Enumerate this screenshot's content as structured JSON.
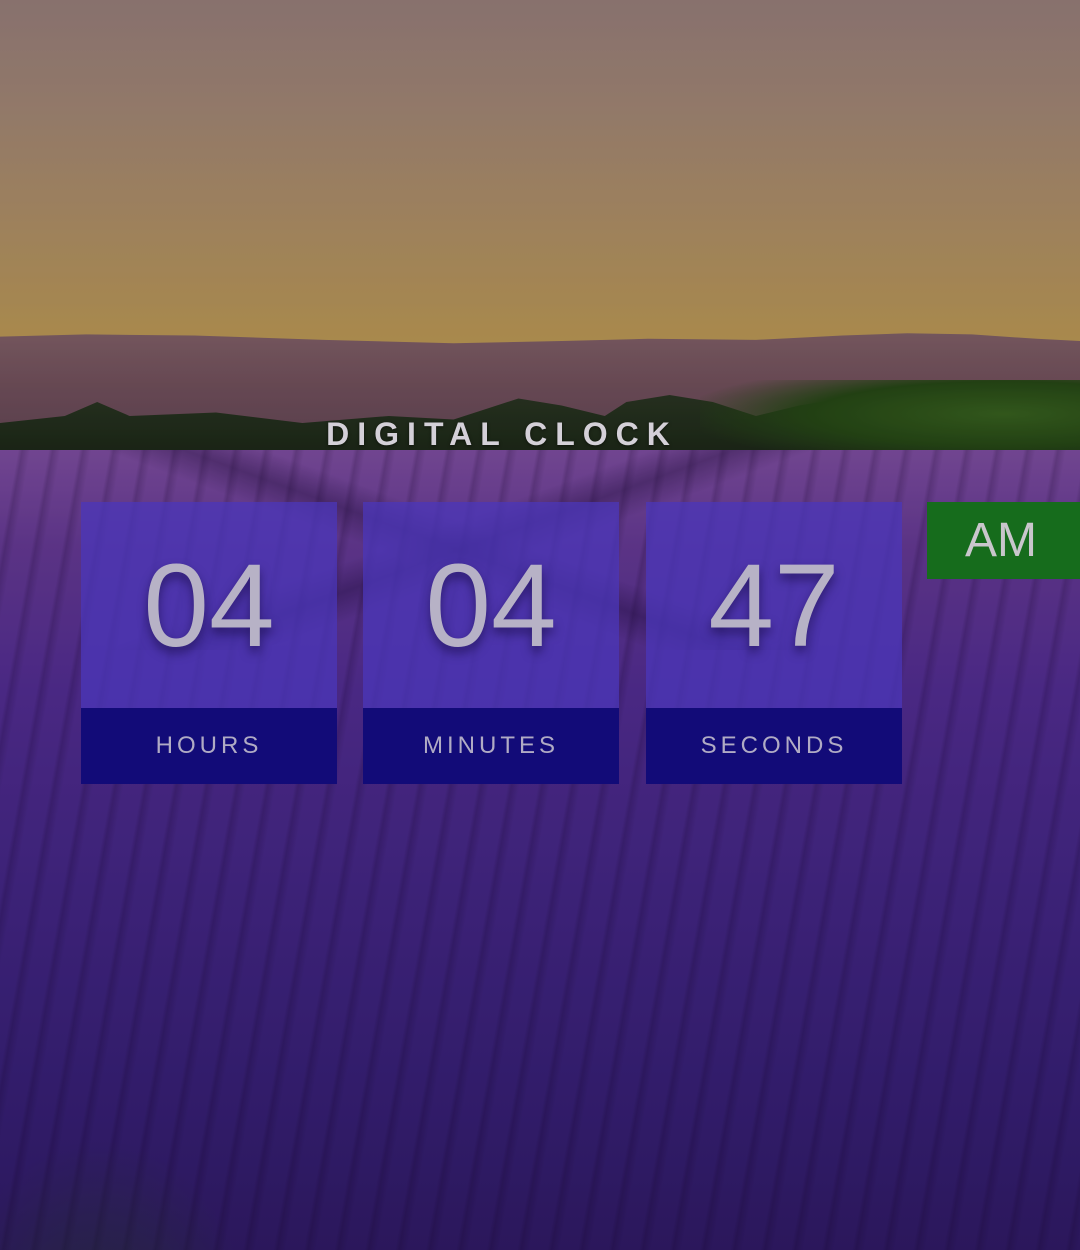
{
  "clock": {
    "title": "DIGITAL CLOCK",
    "hours": {
      "value": "04",
      "label": "HOURS"
    },
    "minutes": {
      "value": "04",
      "label": "MINUTES"
    },
    "seconds": {
      "value": "47",
      "label": "SECONDS"
    },
    "period": "AM"
  },
  "colors": {
    "value_panel": "#4b37b9",
    "label_panel": "#120b78",
    "period_badge": "#166c1c",
    "text": "#b7b2c6"
  }
}
